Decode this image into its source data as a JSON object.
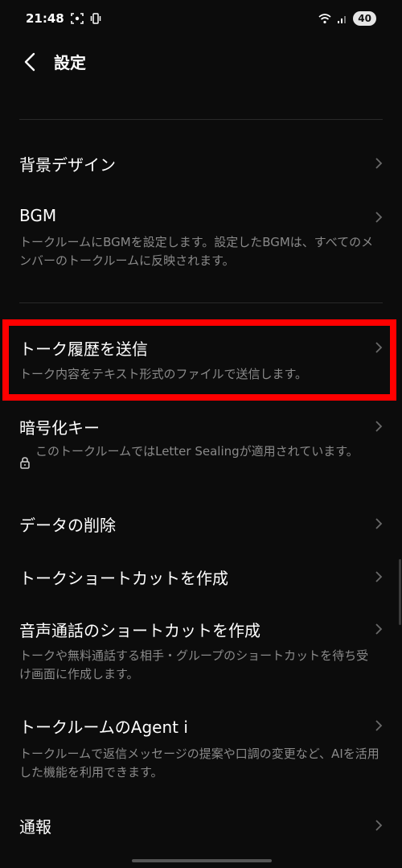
{
  "status": {
    "time": "21:48",
    "battery": "40"
  },
  "header": {
    "title": "設定"
  },
  "items": [
    {
      "title": "背景デザイン",
      "desc": ""
    },
    {
      "title": "BGM",
      "desc": "トークルームにBGMを設定します。設定したBGMは、すべてのメンバーのトークルームに反映されます。"
    },
    {
      "title": "トーク履歴を送信",
      "desc": "トーク内容をテキスト形式のファイルで送信します。"
    },
    {
      "title": "暗号化キー",
      "desc": "このトークルームではLetter Sealingが適用されています。"
    },
    {
      "title": "データの削除",
      "desc": ""
    },
    {
      "title": "トークショートカットを作成",
      "desc": ""
    },
    {
      "title": "音声通話のショートカットを作成",
      "desc": "トークや無料通話する相手・グループのショートカットを待ち受け画面に作成します。"
    },
    {
      "title": "トークルームのAgent i",
      "desc": "トークルームで返信メッセージの提案や口調の変更など、AIを活用した機能を利用できます。"
    },
    {
      "title": "通報",
      "desc": ""
    }
  ]
}
